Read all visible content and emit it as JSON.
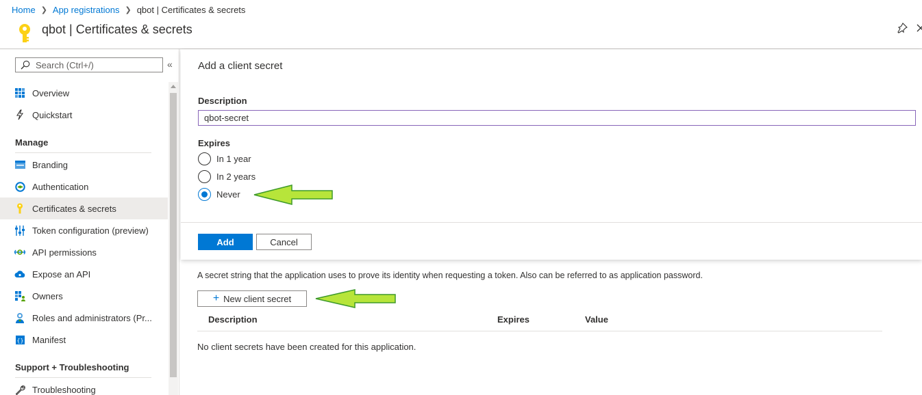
{
  "breadcrumb": {
    "home": "Home",
    "app_registrations": "App registrations",
    "current": "qbot | Certificates & secrets"
  },
  "header": {
    "title": "qbot | Certificates & secrets",
    "icon": "key-icon"
  },
  "sidebar": {
    "search_placeholder": "Search (Ctrl+/)",
    "collapse": "«",
    "items_top": [
      {
        "label": "Overview",
        "icon": "overview-grid-icon"
      },
      {
        "label": "Quickstart",
        "icon": "lightning-icon"
      }
    ],
    "manage_title": "Manage",
    "items_manage": [
      {
        "label": "Branding",
        "icon": "branding-icon"
      },
      {
        "label": "Authentication",
        "icon": "authentication-icon"
      },
      {
        "label": "Certificates & secrets",
        "icon": "key-icon",
        "active": true
      },
      {
        "label": "Token configuration (preview)",
        "icon": "token-config-icon"
      },
      {
        "label": "API permissions",
        "icon": "api-permissions-icon"
      },
      {
        "label": "Expose an API",
        "icon": "cloud-icon"
      },
      {
        "label": "Owners",
        "icon": "owners-icon"
      },
      {
        "label": "Roles and administrators (Pr...",
        "icon": "roles-icon"
      },
      {
        "label": "Manifest",
        "icon": "manifest-icon"
      }
    ],
    "support_title": "Support + Troubleshooting",
    "items_support": [
      {
        "label": "Troubleshooting",
        "icon": "wrench-icon"
      }
    ]
  },
  "panel": {
    "title": "Add a client secret",
    "description_label": "Description",
    "description_value": "qbot-secret",
    "expires_label": "Expires",
    "options": [
      {
        "label": "In 1 year",
        "checked": false
      },
      {
        "label": "In 2 years",
        "checked": false
      },
      {
        "label": "Never",
        "checked": true
      }
    ],
    "add_button": "Add",
    "cancel_button": "Cancel"
  },
  "main": {
    "info_text": "A secret string that the application uses to prove its identity when requesting a token. Also can be referred to as application password.",
    "new_secret_button": "New client secret",
    "table_headers": [
      "Description",
      "Expires",
      "Value"
    ],
    "empty_text": "No client secrets have been created for this application."
  },
  "colors": {
    "accent": "#0078d4",
    "input_border": "#8764b8",
    "annotation_arrow": "#b7e53a"
  }
}
